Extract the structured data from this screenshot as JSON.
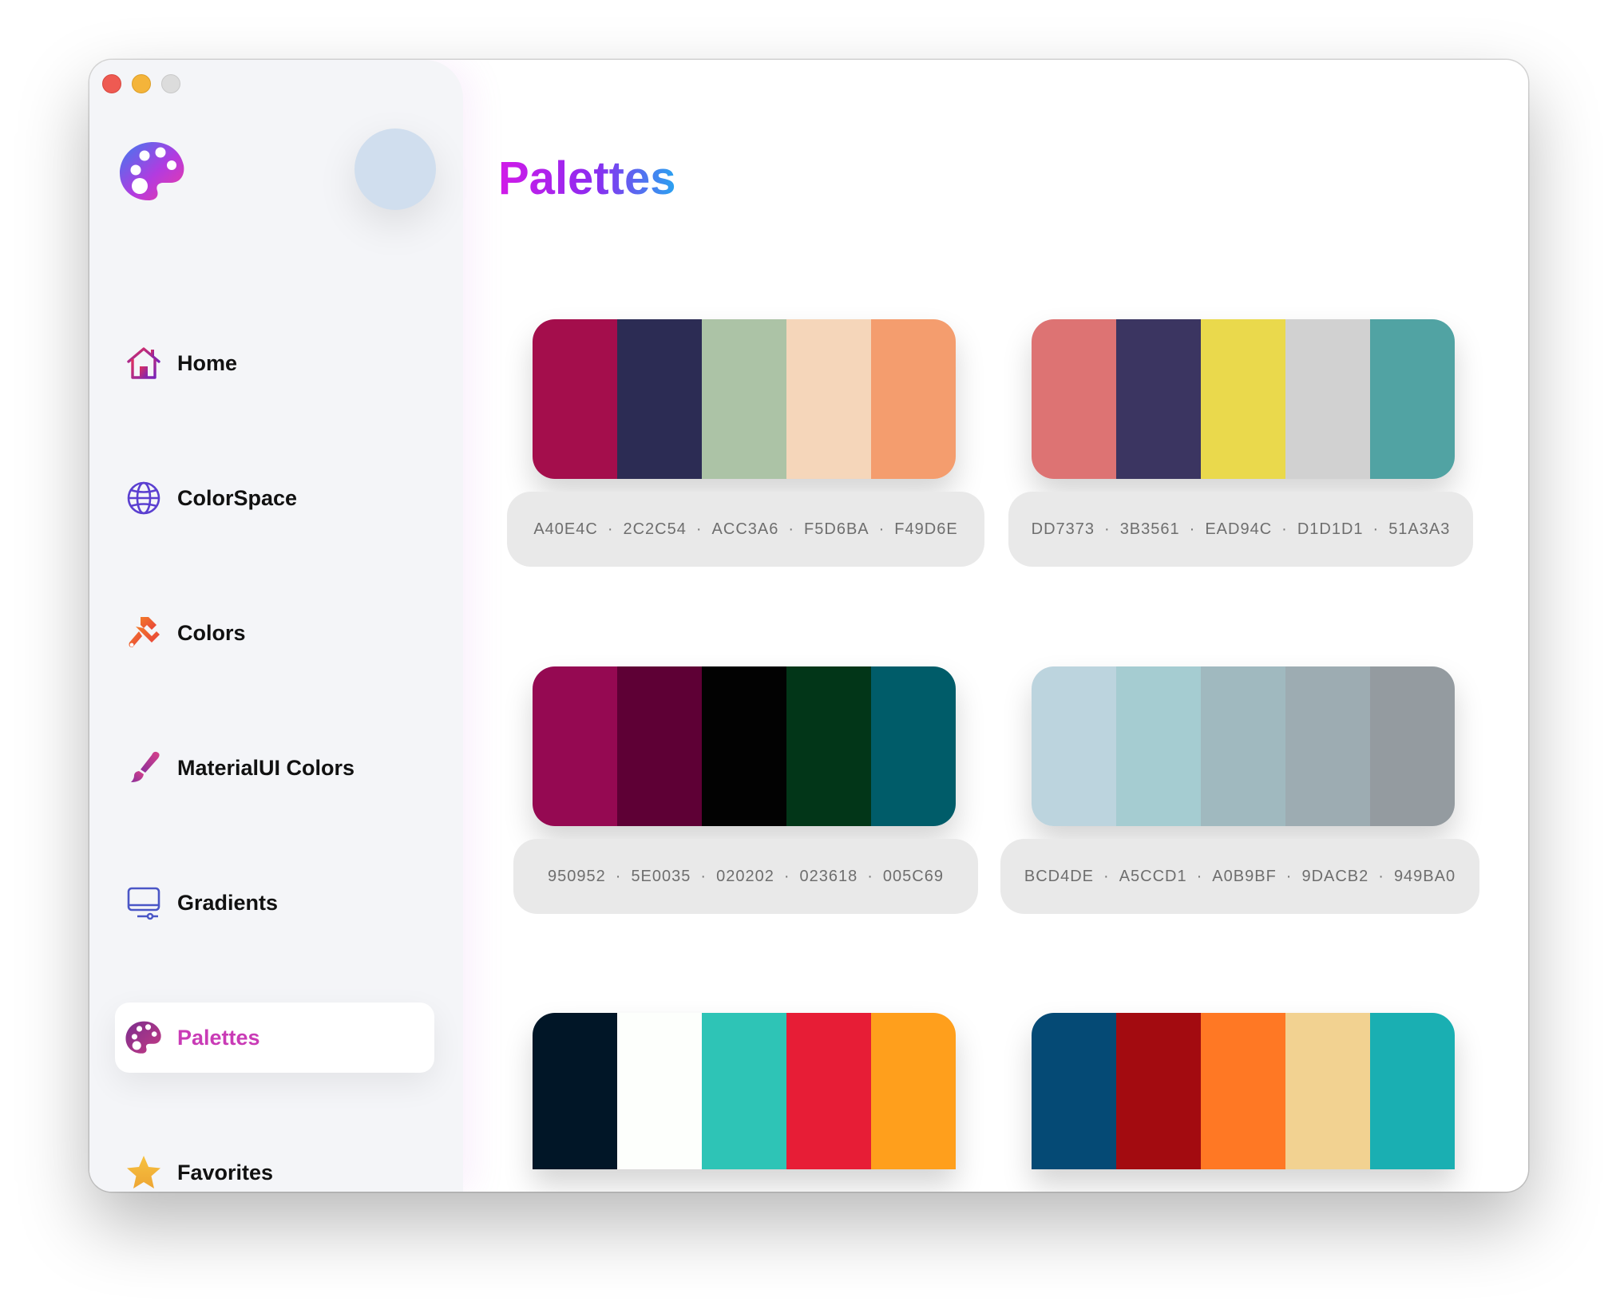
{
  "window": {
    "traffic_lights": [
      "close",
      "minimize",
      "zoom"
    ]
  },
  "sidebar": {
    "logo_icon": "palette-icon",
    "items": [
      {
        "id": "home",
        "label": "Home",
        "icon": "house-icon",
        "color": "#a0207a"
      },
      {
        "id": "colorspace",
        "label": "ColorSpace",
        "icon": "globe-icon",
        "color": "#5b3fd1"
      },
      {
        "id": "colors",
        "label": "Colors",
        "icon": "paintbrush-icon",
        "color": "#ef6a2c"
      },
      {
        "id": "materialui",
        "label": "MaterialUI Colors",
        "icon": "brush-icon",
        "color": "#a33c9c"
      },
      {
        "id": "gradients",
        "label": "Gradients",
        "icon": "display-icon",
        "color": "#4a57c8"
      },
      {
        "id": "palettes",
        "label": "Palettes",
        "icon": "palette-icon",
        "color": "#a13d8c",
        "active": true
      },
      {
        "id": "favorites",
        "label": "Favorites",
        "icon": "star-icon",
        "color": "#f2b233"
      }
    ]
  },
  "main": {
    "title": "Palettes",
    "palettes": [
      {
        "colors": [
          "#A40E4C",
          "#2C2C54",
          "#ACC3A6",
          "#F5D6BA",
          "#F49D6E"
        ],
        "codes": [
          "A40E4C",
          "2C2C54",
          "ACC3A6",
          "F5D6BA",
          "F49D6E"
        ]
      },
      {
        "colors": [
          "#DD7373",
          "#3B3561",
          "#EAD94C",
          "#D1D1D1",
          "#51A3A3"
        ],
        "codes": [
          "DD7373",
          "3B3561",
          "EAD94C",
          "D1D1D1",
          "51A3A3"
        ]
      },
      {
        "colors": [
          "#950952",
          "#5E0035",
          "#020202",
          "#023618",
          "#005C69"
        ],
        "codes": [
          "950952",
          "5E0035",
          "020202",
          "023618",
          "005C69"
        ]
      },
      {
        "colors": [
          "#BCD4DE",
          "#A5CCD1",
          "#A0B9BF",
          "#9DACB2",
          "#949BA0"
        ],
        "codes": [
          "BCD4DE",
          "A5CCD1",
          "A0B9BF",
          "9DACB2",
          "949BA0"
        ]
      },
      {
        "colors": [
          "#011627",
          "#FDFFFC",
          "#2EC4B6",
          "#E71D36",
          "#FF9F1C"
        ],
        "codes": []
      },
      {
        "colors": [
          "#054A75",
          "#A30B10",
          "#FF7824",
          "#F2D291",
          "#1AAFB2"
        ],
        "codes": []
      }
    ]
  }
}
